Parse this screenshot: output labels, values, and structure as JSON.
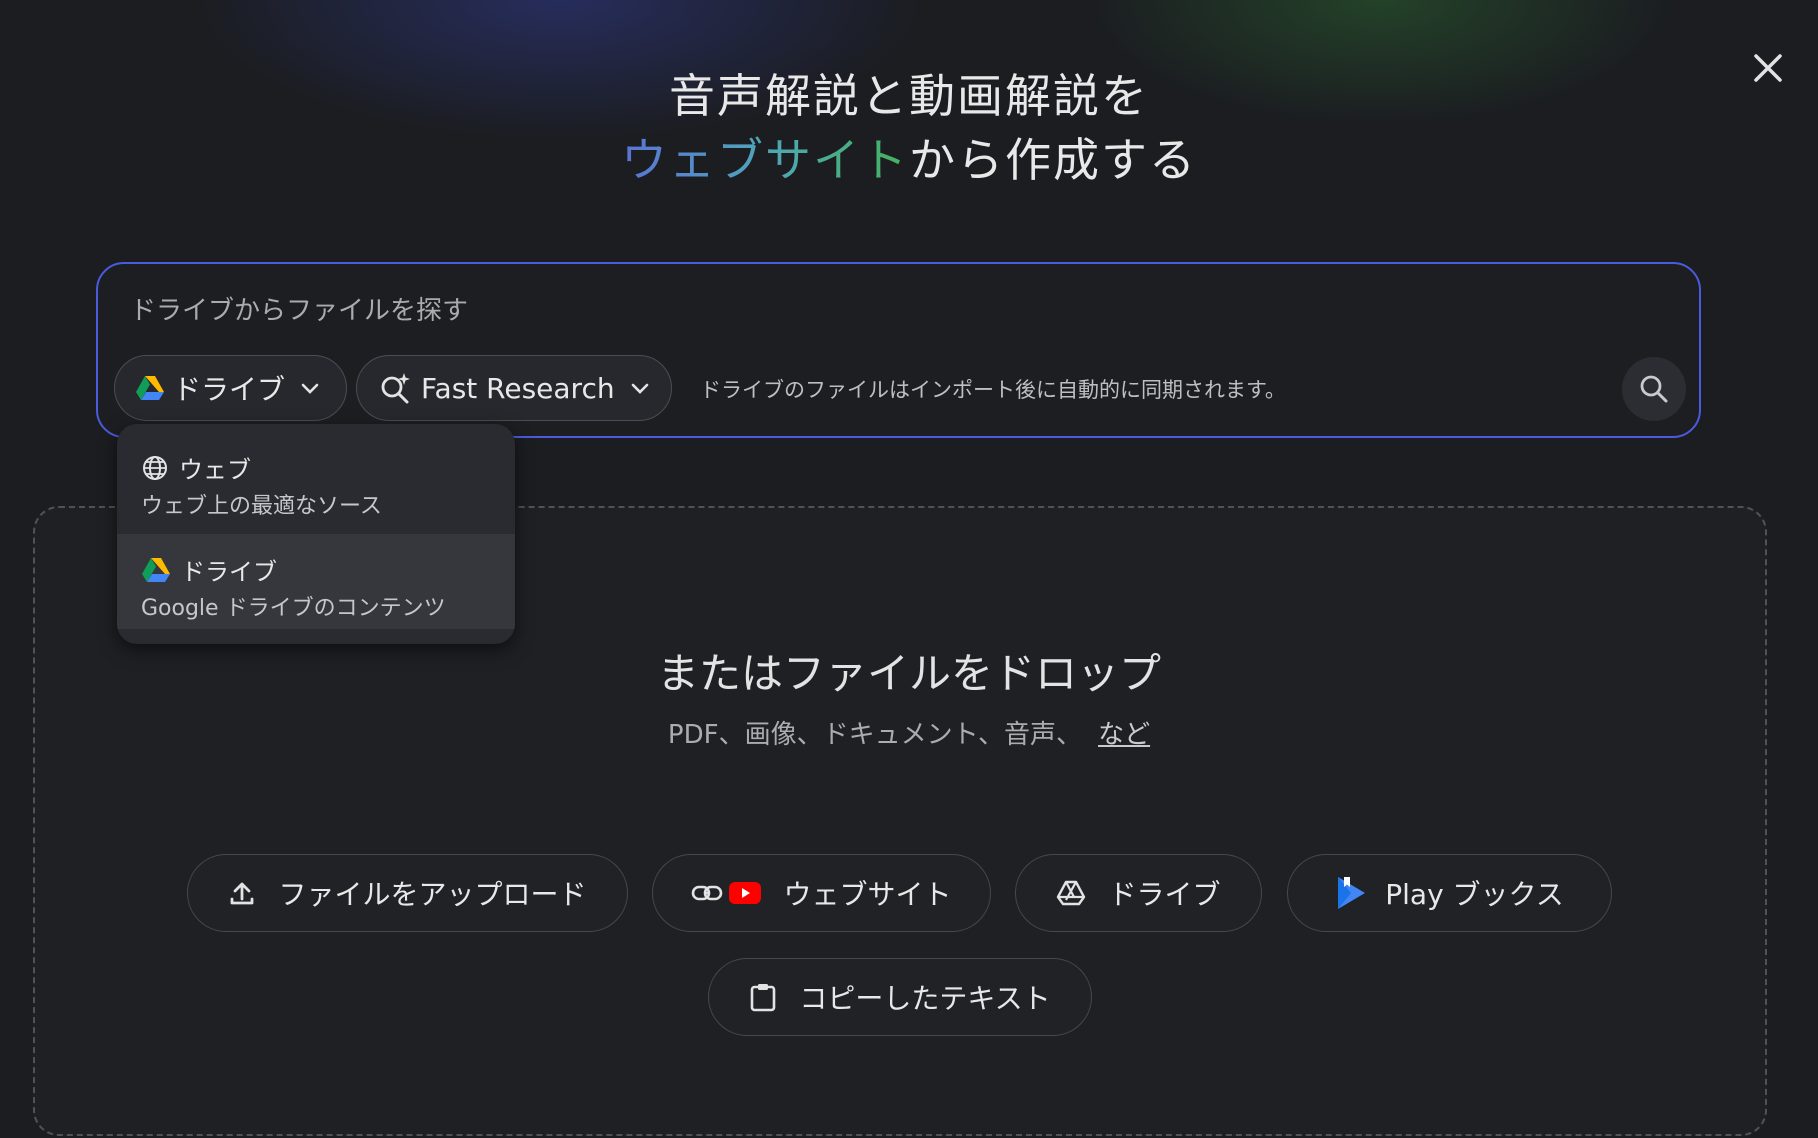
{
  "heading": {
    "line1": "音声解説と動画解説を",
    "line2_highlight": "ウェブサイト",
    "line2_rest": "から作成する"
  },
  "close": {
    "icon": "close-icon"
  },
  "search": {
    "placeholder": "ドライブからファイルを探す",
    "value": "",
    "source_chip": {
      "label": "ドライブ",
      "icon": "google-drive-icon"
    },
    "mode_chip": {
      "label": "Fast Research",
      "icon": "search-sparkle-icon"
    },
    "hint": "ドライブのファイルはインポート後に自動的に同期されます。",
    "submit_icon": "search-icon"
  },
  "source_menu": {
    "items": [
      {
        "title": "ウェブ",
        "desc": "ウェブ上の最適なソース",
        "icon": "globe-icon",
        "selected": false
      },
      {
        "title": "ドライブ",
        "desc": "Google ドライブのコンテンツ",
        "icon": "google-drive-icon",
        "selected": true
      }
    ]
  },
  "dropzone": {
    "title": "またはファイルをドロップ",
    "subtitle": "PDF、画像、ドキュメント、音声、",
    "more_link": "など"
  },
  "buttons": {
    "upload": {
      "label": "ファイルをアップロード",
      "icon": "upload-icon"
    },
    "website": {
      "label": "ウェブサイト",
      "icons": [
        "link-icon",
        "youtube-icon"
      ]
    },
    "drive": {
      "label": "ドライブ",
      "icon": "drive-outline-icon"
    },
    "play_books": {
      "label": "Play ブックス",
      "icon": "play-books-icon"
    },
    "copied_text": {
      "label": "コピーしたテキスト",
      "icon": "clipboard-icon"
    }
  },
  "colors": {
    "background": "#1b1d21",
    "search_border": "#4a5bdb",
    "gradient_start": "#5b73d6",
    "gradient_end": "#45b35a"
  }
}
